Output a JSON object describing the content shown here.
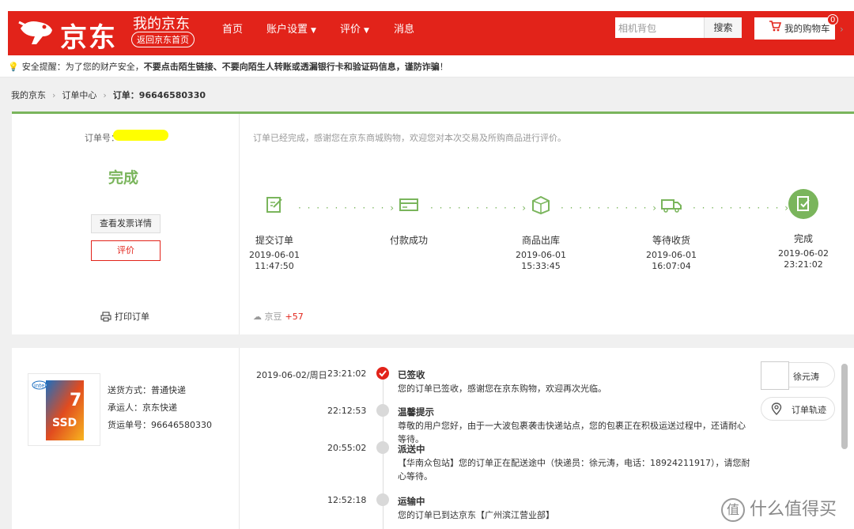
{
  "header": {
    "logo_text": "京东",
    "my_jd": "我的京东",
    "back_home": "返回京东首页",
    "nav": [
      "首页",
      "账户设置",
      "评价",
      "消息"
    ],
    "search_placeholder": "相机背包",
    "search_button": "搜索",
    "cart_label": "我的购物车",
    "cart_count": "0",
    "brand_color": "#e2231a"
  },
  "notice": {
    "prefix": "安全提醒：为了您的财产安全，",
    "bold1": "不要点击陌生链接、不要向陌生人转账或透漏银行卡和验证码信息，谨防诈骗",
    "suffix": "！"
  },
  "breadcrumb": {
    "items": [
      "我的京东",
      "订单中心"
    ],
    "current": "订单：96646580330"
  },
  "order_status": {
    "order_no_label": "订单号：",
    "status": "完成",
    "invoice_button": "查看发票详情",
    "review_button": "评价",
    "print_label": "打印订单",
    "done_message": "订单已经完成，感谢您在京东商城购物，欢迎您对本次交易及所购商品进行评价。",
    "accent_color": "#7ab55c",
    "steps": [
      {
        "name": "提交订单",
        "date": "2019-06-01",
        "time": "11:47:50",
        "icon": "edit-icon"
      },
      {
        "name": "付款成功",
        "date": "",
        "time": "",
        "icon": "card-icon"
      },
      {
        "name": "商品出库",
        "date": "2019-06-01",
        "time": "15:33:45",
        "icon": "box-icon"
      },
      {
        "name": "等待收货",
        "date": "2019-06-01",
        "time": "16:07:04",
        "icon": "truck-icon"
      },
      {
        "name": "完成",
        "date": "2019-06-02",
        "time": "23:21:02",
        "icon": "done-icon"
      }
    ],
    "beans_label": "京豆",
    "beans_value": "+57"
  },
  "shipping": {
    "method": "送货方式：普通快递",
    "carrier": "承运人：京东快递",
    "waybill": "货运单号：96646580330",
    "timeline_date": "2019-06-02/周日",
    "events": [
      {
        "time": "23:21:02",
        "title": "已签收",
        "desc": "您的订单已签收，感谢您在京东购物，欢迎再次光临。"
      },
      {
        "time": "22:12:53",
        "title": "温馨提示",
        "desc": "尊敬的用户您好，由于一大波包裹袭击快递站点，您的包裹正在积极运送过程中，还请耐心等待。"
      },
      {
        "time": "20:55:02",
        "title": "派送中",
        "desc": "【华南众包站】您的订单正在配送途中（快递员：徐元涛，电话：18924211917），请您耐心等待。"
      },
      {
        "time": "12:52:18",
        "title": "运输中",
        "desc": "您的订单已到达京东【广州滨江营业部】"
      }
    ],
    "courier_name": "徐元涛",
    "track_button": "订单轨迹"
  },
  "watermark": "什么值得买"
}
